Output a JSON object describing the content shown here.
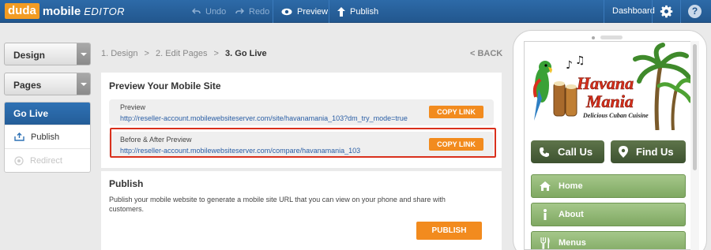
{
  "topbar": {
    "logo_duda": "duda",
    "logo_mobile": "mobile",
    "logo_editor": "EDITOR",
    "undo": "Undo",
    "redo": "Redo",
    "preview": "Preview",
    "publish": "Publish",
    "dashboard": "Dashboard",
    "help": "?"
  },
  "sidebar": {
    "design": "Design",
    "pages": "Pages",
    "golive": "Go Live",
    "publish": "Publish",
    "redirect": "Redirect"
  },
  "breadcrumb": {
    "step1": "1. Design",
    "sep1": ">",
    "step2": "2. Edit Pages",
    "sep2": ">",
    "step3": "3. Go Live",
    "back": "< BACK"
  },
  "preview_section": {
    "title": "Preview Your Mobile Site",
    "preview_label": "Preview",
    "preview_url": "http://reseller-account.mobilewebsiteserver.com/site/havanamania_103?dm_try_mode=true",
    "copy_link": "COPY LINK",
    "before_after_label": "Before & After Preview",
    "before_after_url": "http://reseller-account.mobilewebsiteserver.com/compare/havanamania_103",
    "copy_link_2": "COPY LINK"
  },
  "publish_section": {
    "title": "Publish",
    "description": "Publish your mobile website to generate a mobile site URL that you can view on your phone and share with customers.",
    "button": "PUBLISH"
  },
  "mobile_preview": {
    "logo_line1": "Havana",
    "logo_line2": "Mania",
    "logo_tagline": "Delicious Cuban Cuisine",
    "call_us": "Call Us",
    "find_us": "Find Us",
    "nav": [
      "Home",
      "About",
      "Menus"
    ]
  },
  "colors": {
    "brand_blue": "#22578e",
    "accent_orange": "#f28b1e",
    "highlight_red": "#d9301c",
    "mobile_green": "#7fa862"
  }
}
